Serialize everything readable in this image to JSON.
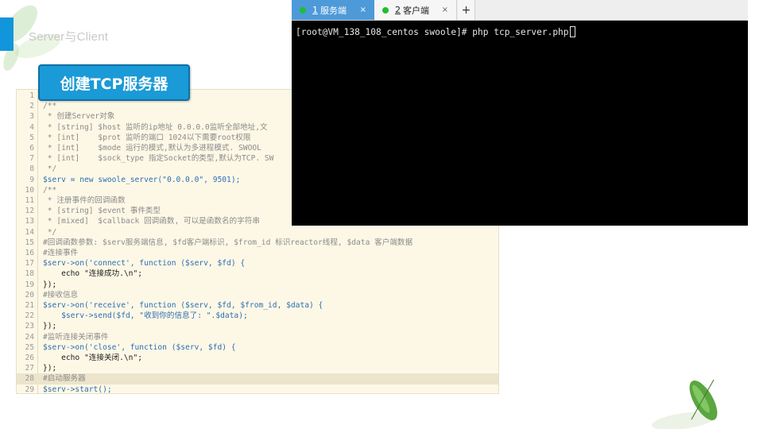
{
  "slide": {
    "header": "Server与Client",
    "title": "创建TCP服务器",
    "accent_color": "#1296db"
  },
  "terminal": {
    "tabs": [
      {
        "number": "1",
        "label": "服务端",
        "active": true,
        "status_color": "#1fbf2f"
      },
      {
        "number": "2",
        "label": "客户端",
        "active": false,
        "status_color": "#1fbf2f"
      }
    ],
    "close_glyph": "×",
    "add_tab_glyph": "+",
    "prompt": "[root@VM_138_108_centos swoole]# ",
    "command": "php tcp_server.php"
  },
  "code_editor": {
    "highlighted_line": 28,
    "lines": [
      {
        "n": "1",
        "t": ""
      },
      {
        "n": "2",
        "t": "/**"
      },
      {
        "n": "3",
        "t": " * 创建Server对象"
      },
      {
        "n": "4",
        "t": " * [string] $host 监听的ip地址 0.0.0.0监听全部地址,文"
      },
      {
        "n": "5",
        "t": " * [int]    $prot 监听的端口 1024以下需要root权限"
      },
      {
        "n": "6",
        "t": " * [int]    $mode 运行的模式,默认为多进程模式. SWOOL"
      },
      {
        "n": "7",
        "t": " * [int]    $sock_type 指定Socket的类型,默认为TCP. SW"
      },
      {
        "n": "8",
        "t": " */"
      },
      {
        "n": "9",
        "t": "$serv = new swoole_server(\"0.0.0.0\", 9501);"
      },
      {
        "n": "10",
        "t": "/**"
      },
      {
        "n": "11",
        "t": " * 注册事件的回调函数"
      },
      {
        "n": "12",
        "t": " * [string] $event 事件类型"
      },
      {
        "n": "13",
        "t": " * [mixed]  $callback 回调函数, 可以是函数名的字符串"
      },
      {
        "n": "14",
        "t": " */"
      },
      {
        "n": "15",
        "t": "#回调函数参数: $serv服务端信息, $fd客户端标识, $from_id 标识reactor线程, $data 客户端数据"
      },
      {
        "n": "16",
        "t": "#连接事件"
      },
      {
        "n": "17",
        "t": "$serv->on('connect', function ($serv, $fd) {"
      },
      {
        "n": "18",
        "t": "    echo \"连接成功.\\n\";"
      },
      {
        "n": "19",
        "t": "});"
      },
      {
        "n": "20",
        "t": "#接收信息"
      },
      {
        "n": "21",
        "t": "$serv->on('receive', function ($serv, $fd, $from_id, $data) {"
      },
      {
        "n": "22",
        "t": "    $serv->send($fd, \"收到你的信息了: \".$data);"
      },
      {
        "n": "23",
        "t": "});"
      },
      {
        "n": "24",
        "t": "#监听连接关闭事件"
      },
      {
        "n": "25",
        "t": "$serv->on('close', function ($serv, $fd) {"
      },
      {
        "n": "26",
        "t": "    echo \"连接关闭.\\n\";"
      },
      {
        "n": "27",
        "t": "});"
      },
      {
        "n": "28",
        "t": "#启动服务器"
      },
      {
        "n": "29",
        "t": "$serv->start();"
      }
    ]
  }
}
